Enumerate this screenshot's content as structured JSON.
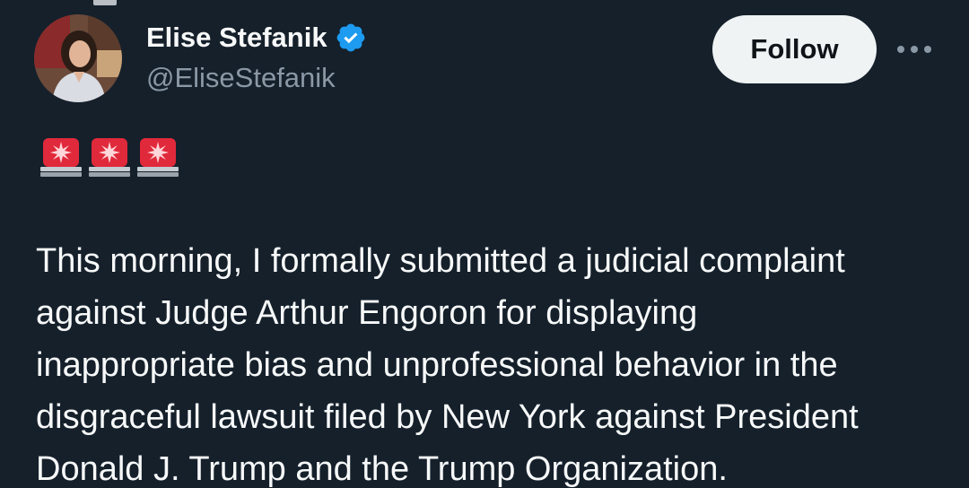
{
  "author": {
    "display_name": "Elise Stefanik",
    "handle": "@EliseStefanik",
    "verified": true,
    "verified_color": "#1d9bf0"
  },
  "actions": {
    "follow_label": "Follow",
    "more_icon": "ellipsis-icon"
  },
  "tweet": {
    "emoji": [
      "police-car-light",
      "police-car-light",
      "police-car-light"
    ],
    "lines": [
      "This morning, I formally submitted a judicial complaint",
      "against Judge Arthur Engoron for displaying",
      "inappropriate bias and unprofessional behavior in the",
      "disgraceful lawsuit filed by New York against President",
      "Donald J. Trump and the Trump Organization."
    ]
  },
  "theme": {
    "background": "#15202b",
    "text": "#f7f9f9",
    "secondary_text": "#8b98a5",
    "button_bg": "#eff3f4"
  }
}
